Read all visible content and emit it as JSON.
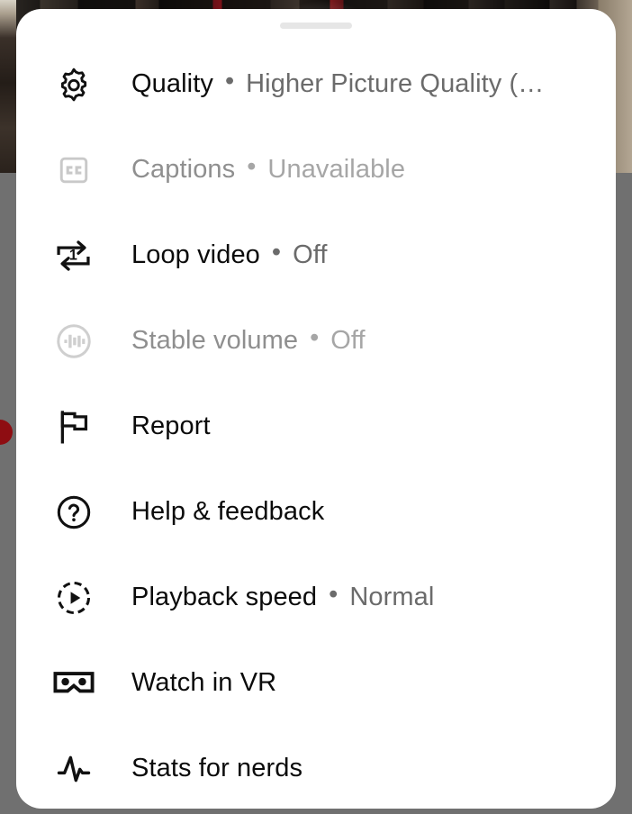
{
  "colors": {
    "sheet_background": "#ffffff",
    "scrim": "#707070",
    "primary_text": "#0b0b0b",
    "secondary_text": "#6b6b6b",
    "disabled_text": "#a6a6a6",
    "drag_handle": "#e6e6e6",
    "accent_red": "#8e0d12"
  },
  "sheet": {
    "drag_handle_name": "drag-handle"
  },
  "menu": {
    "items": [
      {
        "id": "quality",
        "icon": "gear-icon",
        "label": "Quality",
        "separator": "•",
        "value": "Higher Picture Quality (…",
        "disabled": false
      },
      {
        "id": "captions",
        "icon": "closed-captions-icon",
        "label": "Captions",
        "separator": "•",
        "value": "Unavailable",
        "disabled": true
      },
      {
        "id": "loop-video",
        "icon": "repeat-one-icon",
        "label": "Loop video",
        "separator": "•",
        "value": "Off",
        "disabled": false
      },
      {
        "id": "stable-volume",
        "icon": "stable-volume-icon",
        "label": "Stable volume",
        "separator": "•",
        "value": "Off",
        "disabled": true
      },
      {
        "id": "report",
        "icon": "flag-icon",
        "label": "Report",
        "separator": "",
        "value": "",
        "disabled": false
      },
      {
        "id": "help-feedback",
        "icon": "question-circle-icon",
        "label": "Help & feedback",
        "separator": "",
        "value": "",
        "disabled": false
      },
      {
        "id": "playback-speed",
        "icon": "playback-speed-icon",
        "label": "Playback speed",
        "separator": "•",
        "value": "Normal",
        "disabled": false
      },
      {
        "id": "watch-in-vr",
        "icon": "vr-goggles-icon",
        "label": "Watch in VR",
        "separator": "",
        "value": "",
        "disabled": false
      },
      {
        "id": "stats-for-nerds",
        "icon": "pulse-waveform-icon",
        "label": "Stats for nerds",
        "separator": "",
        "value": "",
        "disabled": false
      }
    ]
  }
}
